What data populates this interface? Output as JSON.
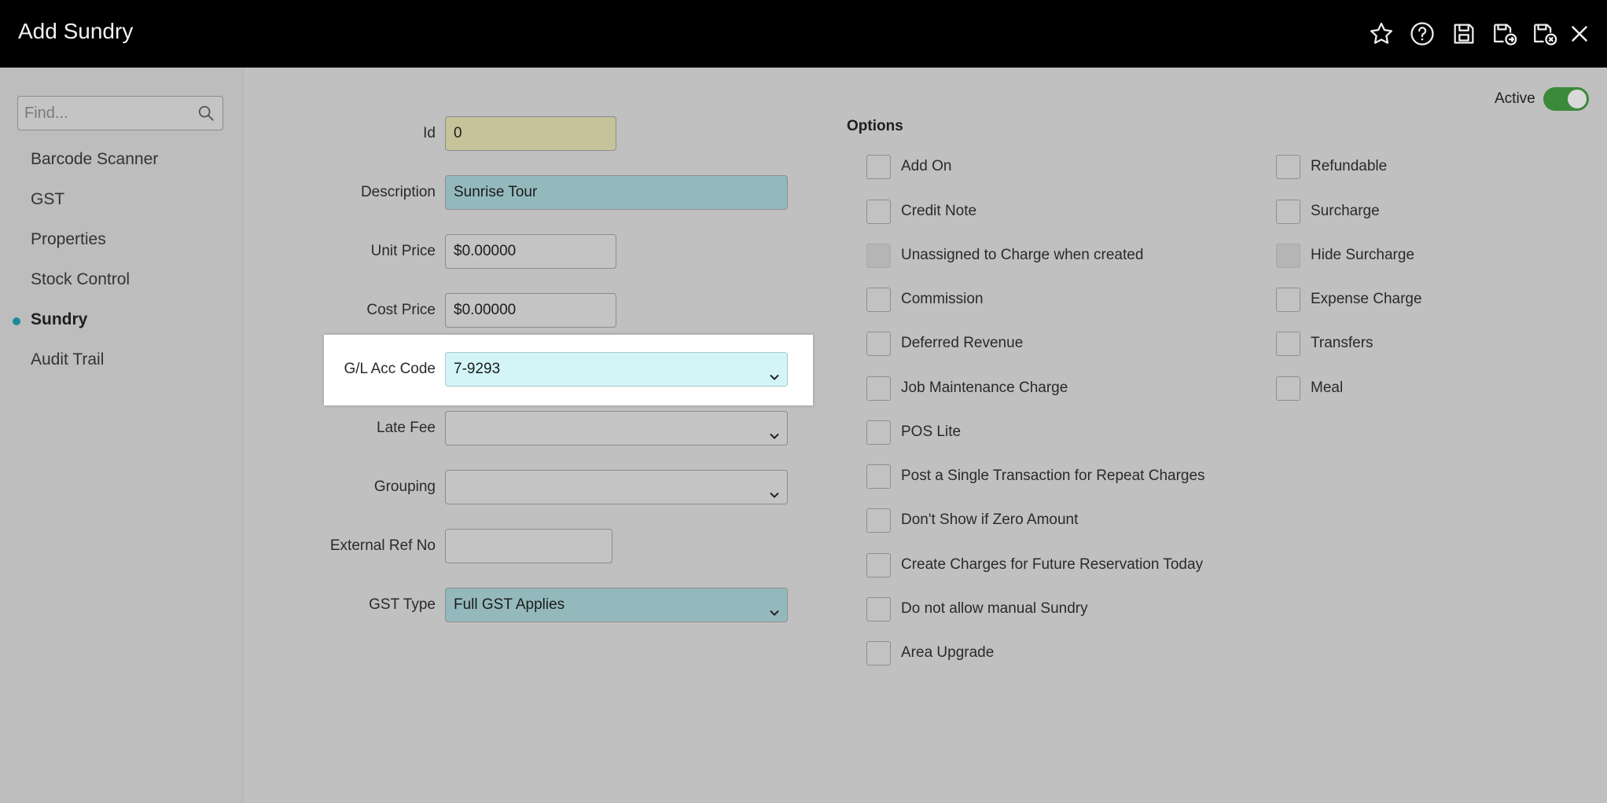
{
  "window": {
    "title": "Add Sundry"
  },
  "header_icons": [
    "star-icon",
    "help-icon",
    "save-icon",
    "save-and-go-icon",
    "save-and-close-icon",
    "close-icon"
  ],
  "sidebar": {
    "search_placeholder": "Find...",
    "items": [
      {
        "label": "Barcode Scanner",
        "active": false
      },
      {
        "label": "GST",
        "active": false
      },
      {
        "label": "Properties",
        "active": false
      },
      {
        "label": "Stock Control",
        "active": false
      },
      {
        "label": "Sundry",
        "active": true
      },
      {
        "label": "Audit Trail",
        "active": false
      }
    ]
  },
  "status": {
    "active_label": "Active",
    "active": true
  },
  "form": {
    "id": {
      "label": "Id",
      "value": "0"
    },
    "description": {
      "label": "Description",
      "value": "Sunrise Tour"
    },
    "unit_price": {
      "label": "Unit Price",
      "value": "$0.00000"
    },
    "cost_price": {
      "label": "Cost Price",
      "value": "$0.00000"
    },
    "gl_acc_code": {
      "label": "G/L Acc Code",
      "value": "7-9293"
    },
    "late_fee": {
      "label": "Late Fee",
      "value": ""
    },
    "grouping": {
      "label": "Grouping",
      "value": ""
    },
    "external_ref": {
      "label": "External Ref No",
      "value": ""
    },
    "gst_type": {
      "label": "GST Type",
      "value": "Full GST Applies"
    }
  },
  "options": {
    "title": "Options",
    "left": [
      {
        "label": "Add On",
        "checked": false,
        "disabled": false
      },
      {
        "label": "Credit Note",
        "checked": false,
        "disabled": false
      },
      {
        "label": "Unassigned to Charge when created",
        "checked": false,
        "disabled": true
      },
      {
        "label": "Commission",
        "checked": false,
        "disabled": false
      },
      {
        "label": "Deferred Revenue",
        "checked": false,
        "disabled": false
      },
      {
        "label": "Job Maintenance Charge",
        "checked": false,
        "disabled": false
      },
      {
        "label": "POS Lite",
        "checked": false,
        "disabled": false
      },
      {
        "label": "Post a Single Transaction for Repeat Charges",
        "checked": false,
        "disabled": false
      },
      {
        "label": "Don't Show if Zero Amount",
        "checked": false,
        "disabled": false
      },
      {
        "label": "Create Charges for Future Reservation Today",
        "checked": false,
        "disabled": false
      },
      {
        "label": "Do not allow manual Sundry",
        "checked": false,
        "disabled": false
      },
      {
        "label": "Area Upgrade",
        "checked": false,
        "disabled": false
      }
    ],
    "right": [
      {
        "label": "Refundable",
        "checked": false,
        "disabled": false
      },
      {
        "label": "Surcharge",
        "checked": false,
        "disabled": false
      },
      {
        "label": "Hide Surcharge",
        "checked": false,
        "disabled": true
      },
      {
        "label": "Expense Charge",
        "checked": false,
        "disabled": false
      },
      {
        "label": "Transfers",
        "checked": false,
        "disabled": false
      },
      {
        "label": "Meal",
        "checked": false,
        "disabled": false
      }
    ]
  },
  "colors": {
    "id_field": "#c6c29a",
    "description_field": "#94b9bc",
    "gl_field": "#d3f5f8",
    "gst_field": "#94b9bc",
    "accent": "#1b8a9b",
    "toggle_on": "#3a8a3a"
  }
}
